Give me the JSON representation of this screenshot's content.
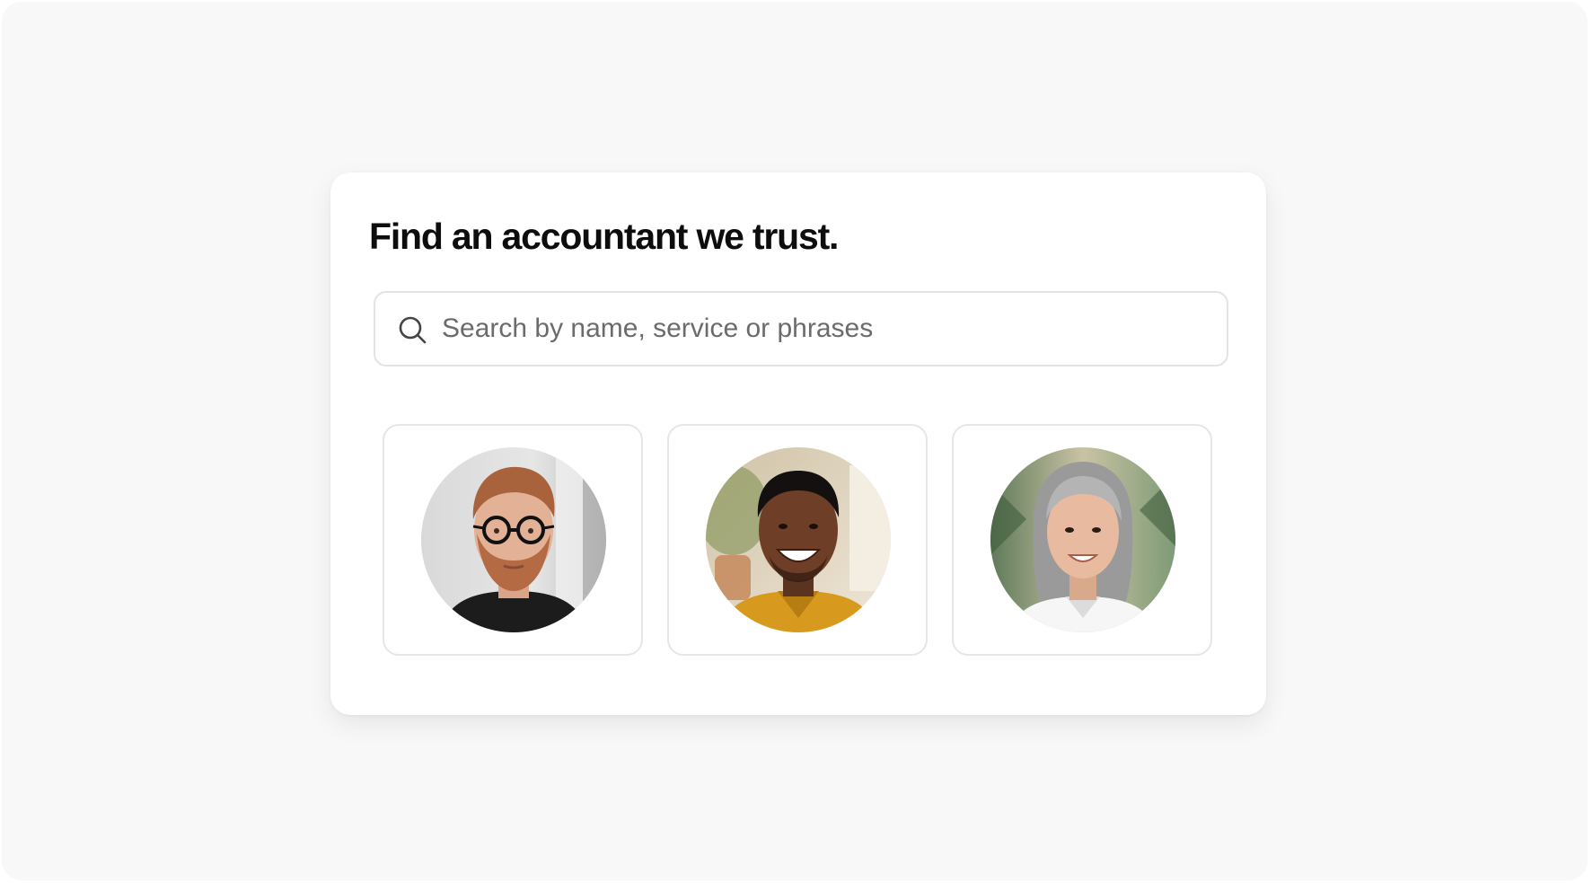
{
  "page": {
    "title": "Find an accountant we trust."
  },
  "search": {
    "placeholder": "Search by name, service or phrases",
    "value": "",
    "icon": "search-icon"
  },
  "profiles": [
    {
      "avatar": "man-with-glasses-avatar"
    },
    {
      "avatar": "smiling-man-avatar"
    },
    {
      "avatar": "gray-haired-woman-avatar"
    }
  ],
  "colors": {
    "background": "#f8f8f8",
    "card": "#ffffff",
    "title": "#0d0d0d",
    "border": "#e3e3e3",
    "placeholder": "#6b6b6b"
  }
}
